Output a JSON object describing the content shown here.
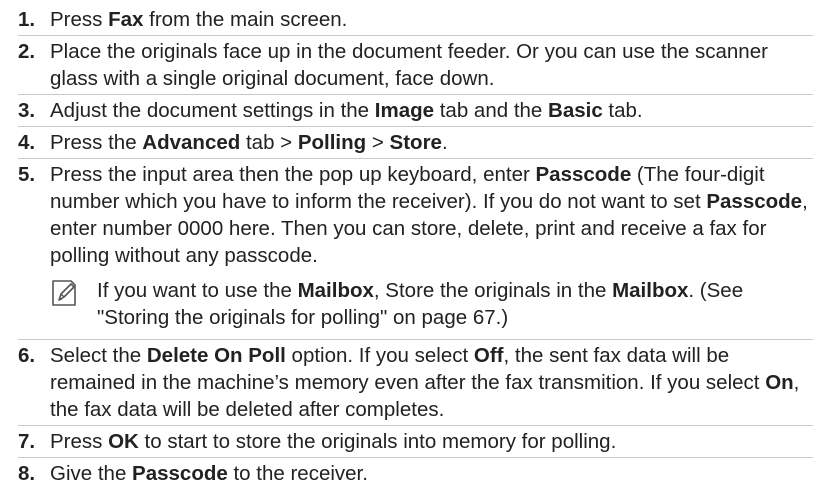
{
  "steps": [
    {
      "num": "1.",
      "parts": [
        "Press ",
        "Fax",
        " from the main screen."
      ]
    },
    {
      "num": "2.",
      "parts": [
        "Place the originals face up in the document feeder. Or you can use the scanner glass with a single original document, face down."
      ]
    },
    {
      "num": "3.",
      "parts": [
        "Adjust the document settings in the ",
        "Image",
        " tab and the ",
        "Basic",
        " tab."
      ]
    },
    {
      "num": "4.",
      "parts": [
        "Press the ",
        "Advanced",
        " tab > ",
        "Polling",
        " > ",
        "Store",
        "."
      ]
    },
    {
      "num": "5.",
      "parts": [
        "Press the input area then the pop up keyboard, enter ",
        "Passcode",
        " (The four-digit number which you have to inform the receiver). If you do not want to set ",
        "Passcode",
        ", enter number 0000 here. Then you can store, delete, print and receive a fax for polling without any passcode."
      ]
    },
    {
      "num": "6.",
      "parts": [
        "Select the ",
        "Delete On Poll",
        " option. If you select ",
        "Off",
        ", the sent fax data will be remained in the machine’s memory even after the fax transmition. If you select ",
        "On",
        ", the fax data will be deleted after completes."
      ]
    },
    {
      "num": "7.",
      "parts": [
        "Press ",
        "OK",
        " to start to store the originals into memory for polling."
      ]
    },
    {
      "num": "8.",
      "parts": [
        "Give the ",
        "Passcode",
        " to the receiver."
      ]
    }
  ],
  "note": {
    "icon": "note-pencil-icon",
    "parts": [
      "If you want to use the ",
      "Mailbox",
      ", Store the originals in the ",
      "Mailbox",
      ". (See \"Storing the originals for polling\" on page 67.)"
    ]
  }
}
